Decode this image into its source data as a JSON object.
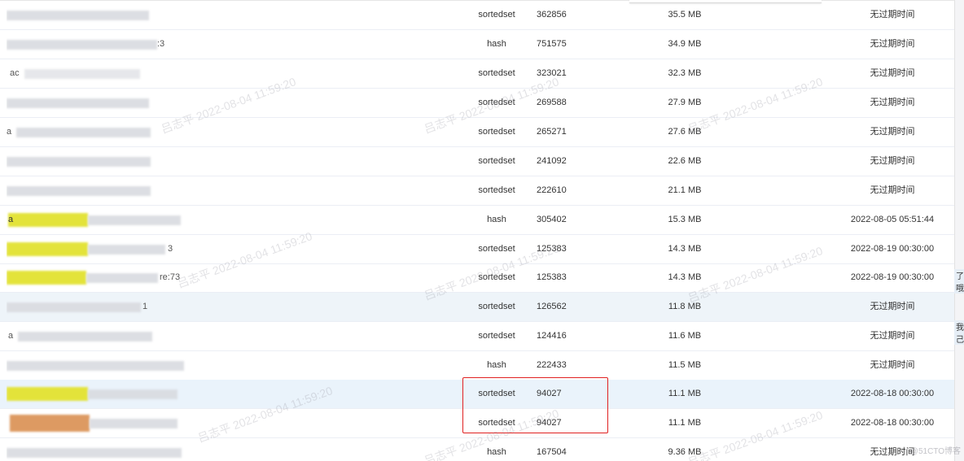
{
  "rows": [
    {
      "key_frag": "",
      "type": "sortedset",
      "count": "362856",
      "size": "35.5 MB",
      "ttl": "无过期时间"
    },
    {
      "key_frag": ":3",
      "type": "hash",
      "count": "751575",
      "size": "34.9 MB",
      "ttl": "无过期时间"
    },
    {
      "key_frag": "ac",
      "type": "sortedset",
      "count": "323021",
      "size": "32.3 MB",
      "ttl": "无过期时间"
    },
    {
      "key_frag": "",
      "type": "sortedset",
      "count": "269588",
      "size": "27.9 MB",
      "ttl": "无过期时间"
    },
    {
      "key_frag": "a",
      "type": "sortedset",
      "count": "265271",
      "size": "27.6 MB",
      "ttl": "无过期时间"
    },
    {
      "key_frag": "",
      "type": "sortedset",
      "count": "241092",
      "size": "22.6 MB",
      "ttl": "无过期时间"
    },
    {
      "key_frag": "",
      "type": "sortedset",
      "count": "222610",
      "size": "21.1 MB",
      "ttl": "无过期时间"
    },
    {
      "key_frag": "a",
      "type": "hash",
      "count": "305402",
      "size": "15.3 MB",
      "ttl": "2022-08-05 05:51:44"
    },
    {
      "key_frag": "3",
      "type": "sortedset",
      "count": "125383",
      "size": "14.3 MB",
      "ttl": "2022-08-19 00:30:00"
    },
    {
      "key_frag": "re:73",
      "type": "sortedset",
      "count": "125383",
      "size": "14.3 MB",
      "ttl": "2022-08-19 00:30:00"
    },
    {
      "key_frag": "1",
      "type": "sortedset",
      "count": "126562",
      "size": "11.8 MB",
      "ttl": "无过期时间"
    },
    {
      "key_frag": "a",
      "type": "sortedset",
      "count": "124416",
      "size": "11.6 MB",
      "ttl": "无过期时间"
    },
    {
      "key_frag": "",
      "type": "hash",
      "count": "222433",
      "size": "11.5 MB",
      "ttl": "无过期时间"
    },
    {
      "key_frag": "",
      "type": "sortedset",
      "count": "94027",
      "size": "11.1 MB",
      "ttl": "2022-08-18 00:30:00"
    },
    {
      "key_frag": "",
      "type": "sortedset",
      "count": "94027",
      "size": "11.1 MB",
      "ttl": "2022-08-18 00:30:00"
    },
    {
      "key_frag": "",
      "type": "hash",
      "count": "167504",
      "size": "9.36 MB",
      "ttl": "无过期时间"
    }
  ],
  "watermark_text": "吕志平 2022-08-04 11:59:20",
  "side_fragments": [
    "了哦",
    "我己"
  ],
  "corner_mark": "@51CTO博客",
  "colors": {
    "highlight_red": "#e02020",
    "marker_yellow": "#e3e33a",
    "marker_orange": "#dd9a62",
    "row_hover": "#eef4f9"
  }
}
